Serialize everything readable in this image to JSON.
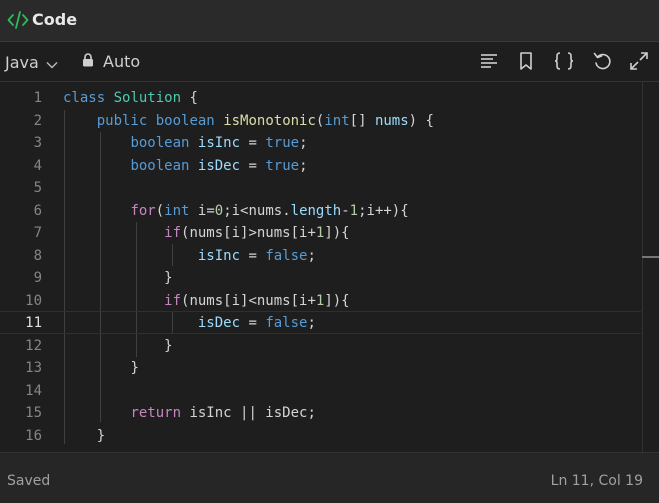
{
  "title": {
    "text": "Code",
    "icon": "code-icon",
    "icon_color": "#2cbb5d"
  },
  "toolbar": {
    "language": "Java",
    "mode": "Auto",
    "icons": [
      "format-icon",
      "bookmark-icon",
      "braces-icon",
      "reset-icon",
      "expand-icon"
    ]
  },
  "editor": {
    "current_line": 11,
    "lines": [
      {
        "n": "1"
      },
      {
        "n": "2"
      },
      {
        "n": "3"
      },
      {
        "n": "4"
      },
      {
        "n": "5"
      },
      {
        "n": "6"
      },
      {
        "n": "7"
      },
      {
        "n": "8"
      },
      {
        "n": "9"
      },
      {
        "n": "10"
      },
      {
        "n": "11"
      },
      {
        "n": "12"
      },
      {
        "n": "13"
      },
      {
        "n": "14"
      },
      {
        "n": "15"
      },
      {
        "n": "16"
      }
    ]
  },
  "tokens": {
    "class_kw": "class",
    "class_name": "Solution",
    "open_brace": " {",
    "public_kw": "public",
    "boolean_kw": "boolean",
    "method_name": "isMonotonic",
    "int_kw": "int",
    "params_rest": "[] ",
    "param_name": "nums",
    "sig_end": ") {",
    "isInc": "isInc",
    "isDec": "isDec",
    "assign": " = ",
    "true_kw": "true",
    "false_kw": "false",
    "semicolon": ";",
    "for_kw": "for",
    "for_open": "(",
    "for_var": " i=",
    "zero": "0",
    "for_cond": ";i<nums.",
    "length": "length",
    "minus": "-",
    "one": "1",
    "for_end": ";i++){",
    "if_kw": "if",
    "if_gt": "(nums[i]>nums[i+",
    "if_lt": "(nums[i]<nums[i+",
    "if_end": "]){",
    "close_brace": "}",
    "return_kw": "return",
    "return_expr": " isInc || isDec;"
  },
  "status": {
    "left": "Saved",
    "right": "Ln 11, Col 19"
  }
}
